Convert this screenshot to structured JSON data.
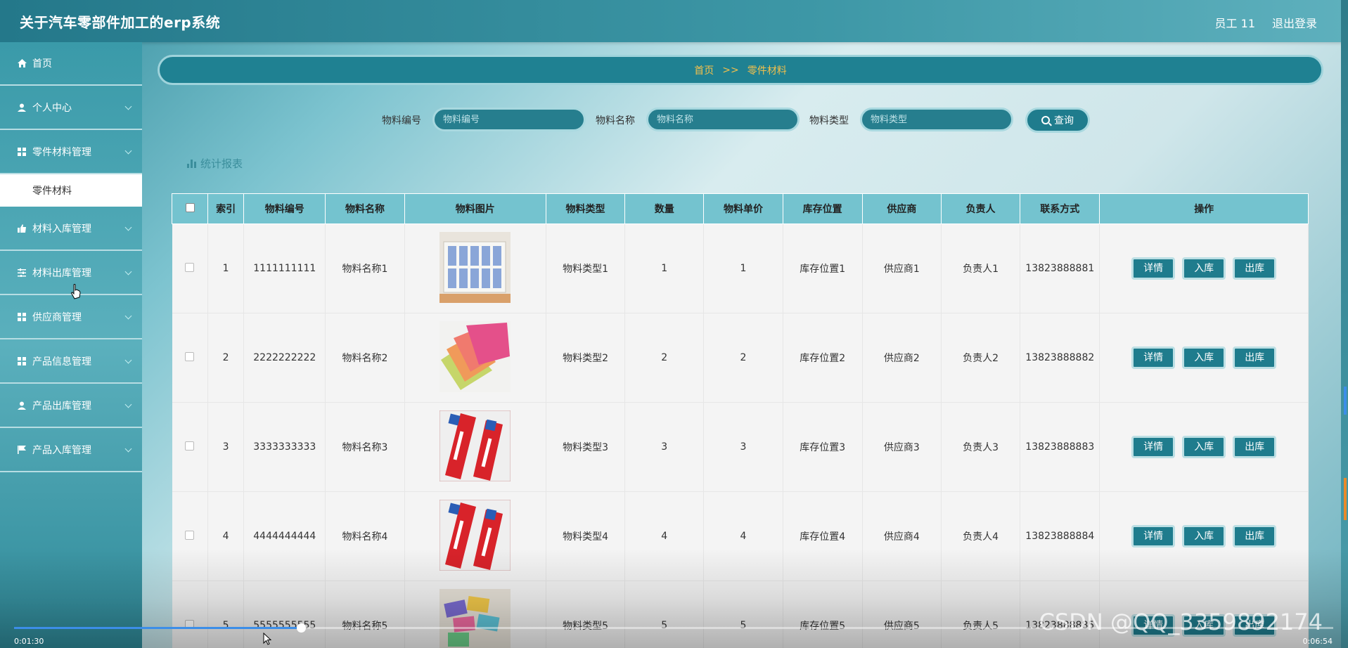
{
  "header": {
    "app_title": "关于汽车零部件加工的erp系统",
    "user": "员工 11",
    "logout": "退出登录"
  },
  "sidebar": {
    "items": [
      {
        "label": "首页",
        "icon": "home-icon"
      },
      {
        "label": "个人中心",
        "icon": "person-icon"
      },
      {
        "label": "零件材料管理",
        "icon": "grid-icon"
      },
      {
        "label": "材料入库管理",
        "icon": "thumb-up-icon"
      },
      {
        "label": "材料出库管理",
        "icon": "sliders-icon"
      },
      {
        "label": "供应商管理",
        "icon": "grid-icon"
      },
      {
        "label": "产品信息管理",
        "icon": "grid-icon"
      },
      {
        "label": "产品出库管理",
        "icon": "person-icon"
      },
      {
        "label": "产品入库管理",
        "icon": "flag-icon"
      }
    ],
    "submenu_active": "零件材料"
  },
  "breadcrumb": {
    "home": "首页",
    "separator": ">>",
    "current": "零件材料"
  },
  "search": {
    "code_label": "物料编号",
    "code_placeholder": "物料编号",
    "name_label": "物料名称",
    "name_placeholder": "物料名称",
    "type_label": "物料类型",
    "type_placeholder": "物料类型",
    "button": "查询"
  },
  "stats_link": "统计报表",
  "table": {
    "columns": [
      "索引",
      "物料编号",
      "物料名称",
      "物料图片",
      "物料类型",
      "数量",
      "物料单价",
      "库存位置",
      "供应商",
      "负责人",
      "联系方式",
      "操作"
    ],
    "rows": [
      {
        "index": "1",
        "code": "1111111111",
        "name": "物料名称1",
        "image": "tissue-pack",
        "type": "物料类型1",
        "qty": "1",
        "price": "1",
        "location": "库存位置1",
        "supplier": "供应商1",
        "owner": "负责人1",
        "phone": "13823888881"
      },
      {
        "index": "2",
        "code": "2222222222",
        "name": "物料名称2",
        "image": "cloths",
        "type": "物料类型2",
        "qty": "2",
        "price": "2",
        "location": "库存位置2",
        "supplier": "供应商2",
        "owner": "负责人2",
        "phone": "13823888882"
      },
      {
        "index": "3",
        "code": "3333333333",
        "name": "物料名称3",
        "image": "toothpaste",
        "type": "物料类型3",
        "qty": "3",
        "price": "3",
        "location": "库存位置3",
        "supplier": "供应商3",
        "owner": "负责人3",
        "phone": "13823888883"
      },
      {
        "index": "4",
        "code": "4444444444",
        "name": "物料名称4",
        "image": "toothpaste",
        "type": "物料类型4",
        "qty": "4",
        "price": "4",
        "location": "库存位置4",
        "supplier": "供应商4",
        "owner": "负责人4",
        "phone": "13823888884"
      },
      {
        "index": "5",
        "code": "5555555555",
        "name": "物料名称5",
        "image": "sponges",
        "type": "物料类型5",
        "qty": "5",
        "price": "5",
        "location": "库存位置5",
        "supplier": "供应商5",
        "owner": "负责人5",
        "phone": "13823888885"
      }
    ],
    "actions": {
      "detail": "详情",
      "stock_in": "入库",
      "stock_out": "出库"
    }
  },
  "video": {
    "current_time": "0:01:30",
    "total_time": "0:06:54",
    "progress": 0.2174
  },
  "watermark": "CSDN @QQ_3359892174",
  "colors": {
    "accent": "#1f7c8d",
    "breadcrumb_text": "#f3c04c",
    "table_header": "#74c3cf",
    "progress": "#3c8ee8"
  }
}
